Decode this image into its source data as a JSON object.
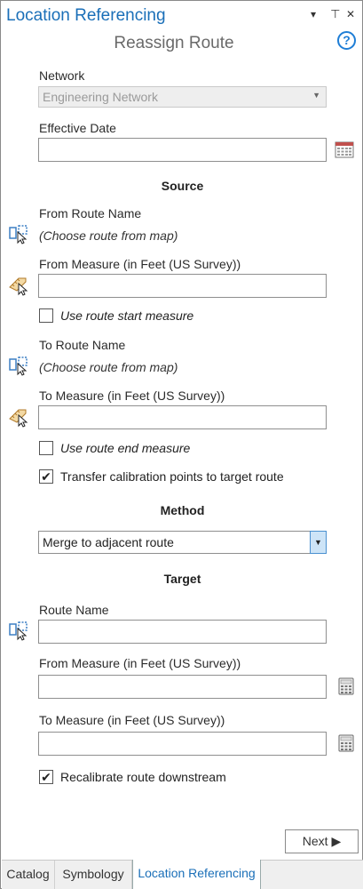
{
  "pane": {
    "title": "Location Referencing",
    "controls": {
      "dropdown": "▾",
      "pin": "⊥",
      "close": "✕"
    }
  },
  "tool": {
    "title": "Reassign Route",
    "help": "?"
  },
  "network": {
    "label": "Network",
    "value": "Engineering Network"
  },
  "effective_date": {
    "label": "Effective Date",
    "value": ""
  },
  "source": {
    "heading": "Source",
    "from_route_label": "From Route Name",
    "from_route_value": "(Choose route from map)",
    "from_measure_label": "From Measure (in Feet (US Survey))",
    "from_measure_value": "",
    "use_start_label": "Use route start measure",
    "use_start_checked": false,
    "to_route_label": "To Route Name",
    "to_route_value": "(Choose route from map)",
    "to_measure_label": "To Measure (in Feet (US Survey))",
    "to_measure_value": "",
    "use_end_label": "Use route end measure",
    "use_end_checked": false,
    "transfer_label": "Transfer calibration points to target route",
    "transfer_checked": true
  },
  "method": {
    "heading": "Method",
    "value": "Merge to adjacent route"
  },
  "target": {
    "heading": "Target",
    "route_label": "Route Name",
    "route_value": "",
    "from_measure_label": "From Measure (in Feet (US Survey))",
    "from_measure_value": "",
    "to_measure_label": "To Measure (in Feet (US Survey))",
    "to_measure_value": "",
    "recalibrate_label": "Recalibrate route downstream",
    "recalibrate_checked": true
  },
  "next_button": "Next ▶",
  "tabs": [
    {
      "label": "Catalog",
      "active": false
    },
    {
      "label": "Symbology",
      "active": false
    },
    {
      "label": "Location Referencing",
      "active": true
    }
  ],
  "colors": {
    "accent": "#1a6fb8",
    "dropdown_highlight": "#cde4f7"
  },
  "icons": {
    "map_select": "route-select-icon",
    "map_measure": "measure-pick-icon",
    "calendar": "calendar-icon",
    "calculator": "calculator-icon"
  }
}
